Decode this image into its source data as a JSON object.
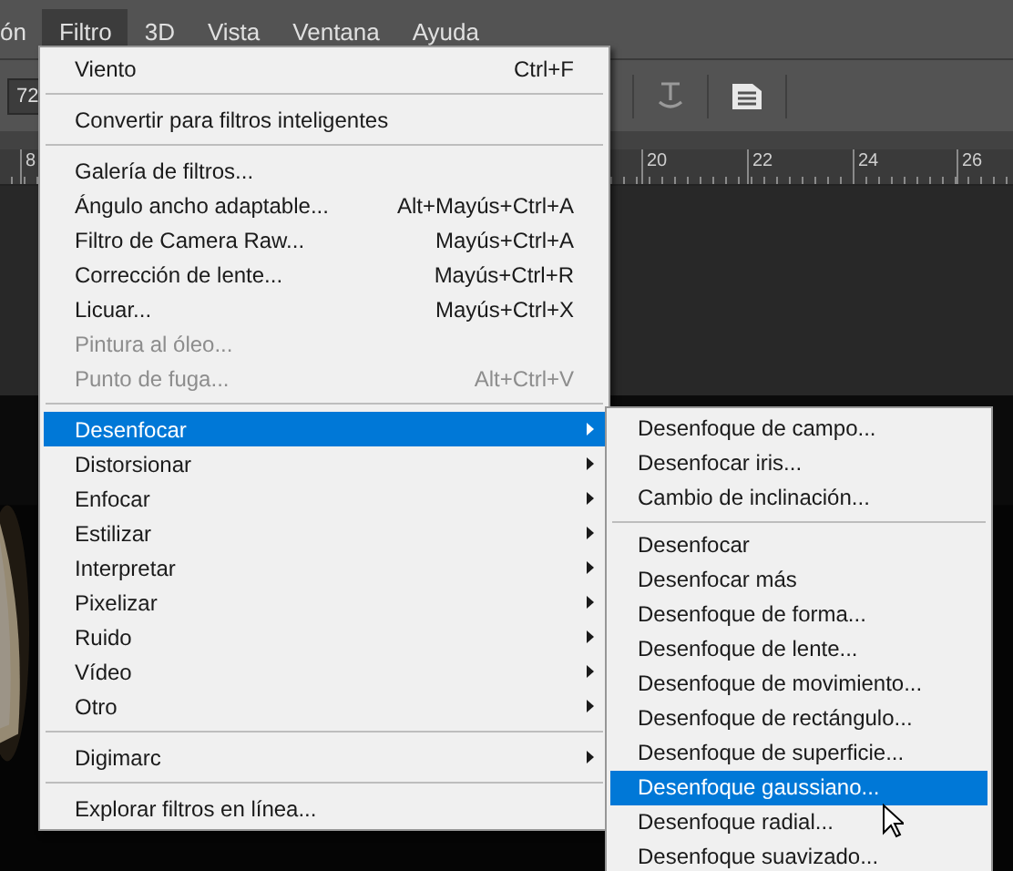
{
  "menu_bar": [
    {
      "label": "ón",
      "selected": false
    },
    {
      "label": "Filtro",
      "selected": true
    },
    {
      "label": "3D",
      "selected": false
    },
    {
      "label": "Vista",
      "selected": false
    },
    {
      "label": "Ventana",
      "selected": false
    },
    {
      "label": "Ayuda",
      "selected": false
    }
  ],
  "options_bar": {
    "field_value": "72"
  },
  "ruler": {
    "labels": [
      {
        "text": "8"
      },
      {
        "text": "20"
      },
      {
        "text": "22"
      },
      {
        "text": "24"
      },
      {
        "text": "26"
      }
    ]
  },
  "filter_menu": {
    "groups": [
      [
        {
          "label": "Viento",
          "shortcut": "Ctrl+F",
          "disabled": false,
          "selected": false,
          "submenu": false
        }
      ],
      [
        {
          "label": "Convertir para filtros inteligentes",
          "disabled": false,
          "selected": false,
          "submenu": false
        }
      ],
      [
        {
          "label": "Galería de filtros...",
          "disabled": false,
          "selected": false,
          "submenu": false
        },
        {
          "label": "Ángulo ancho adaptable...",
          "shortcut": "Alt+Mayús+Ctrl+A",
          "disabled": false,
          "selected": false,
          "submenu": false
        },
        {
          "label": "Filtro de Camera Raw...",
          "shortcut": "Mayús+Ctrl+A",
          "disabled": false,
          "selected": false,
          "submenu": false
        },
        {
          "label": "Corrección de lente...",
          "shortcut": "Mayús+Ctrl+R",
          "disabled": false,
          "selected": false,
          "submenu": false
        },
        {
          "label": "Licuar...",
          "shortcut": "Mayús+Ctrl+X",
          "disabled": false,
          "selected": false,
          "submenu": false
        },
        {
          "label": "Pintura al óleo...",
          "disabled": true,
          "selected": false,
          "submenu": false
        },
        {
          "label": "Punto de fuga...",
          "shortcut": "Alt+Ctrl+V",
          "disabled": true,
          "selected": false,
          "submenu": false
        }
      ],
      [
        {
          "label": "Desenfocar",
          "disabled": false,
          "selected": true,
          "submenu": true
        },
        {
          "label": "Distorsionar",
          "disabled": false,
          "selected": false,
          "submenu": true
        },
        {
          "label": "Enfocar",
          "disabled": false,
          "selected": false,
          "submenu": true
        },
        {
          "label": "Estilizar",
          "disabled": false,
          "selected": false,
          "submenu": true
        },
        {
          "label": "Interpretar",
          "disabled": false,
          "selected": false,
          "submenu": true
        },
        {
          "label": "Pixelizar",
          "disabled": false,
          "selected": false,
          "submenu": true
        },
        {
          "label": "Ruido",
          "disabled": false,
          "selected": false,
          "submenu": true
        },
        {
          "label": "Vídeo",
          "disabled": false,
          "selected": false,
          "submenu": true
        },
        {
          "label": "Otro",
          "disabled": false,
          "selected": false,
          "submenu": true
        }
      ],
      [
        {
          "label": "Digimarc",
          "disabled": false,
          "selected": false,
          "submenu": true
        }
      ],
      [
        {
          "label": "Explorar filtros en línea...",
          "disabled": false,
          "selected": false,
          "submenu": false
        }
      ]
    ]
  },
  "blur_submenu": {
    "groups": [
      [
        {
          "label": "Desenfoque de campo...",
          "selected": false
        },
        {
          "label": "Desenfocar iris...",
          "selected": false
        },
        {
          "label": "Cambio de inclinación...",
          "selected": false
        }
      ],
      [
        {
          "label": "Desenfocar",
          "selected": false
        },
        {
          "label": "Desenfocar más",
          "selected": false
        },
        {
          "label": "Desenfoque de forma...",
          "selected": false
        },
        {
          "label": "Desenfoque de lente...",
          "selected": false
        },
        {
          "label": "Desenfoque de movimiento...",
          "selected": false
        },
        {
          "label": "Desenfoque de rectángulo...",
          "selected": false
        },
        {
          "label": "Desenfoque de superficie...",
          "selected": false
        },
        {
          "label": "Desenfoque gaussiano...",
          "selected": true
        },
        {
          "label": "Desenfoque radial...",
          "selected": false
        },
        {
          "label": "Desenfoque suavizado...",
          "selected": false
        }
      ]
    ]
  }
}
